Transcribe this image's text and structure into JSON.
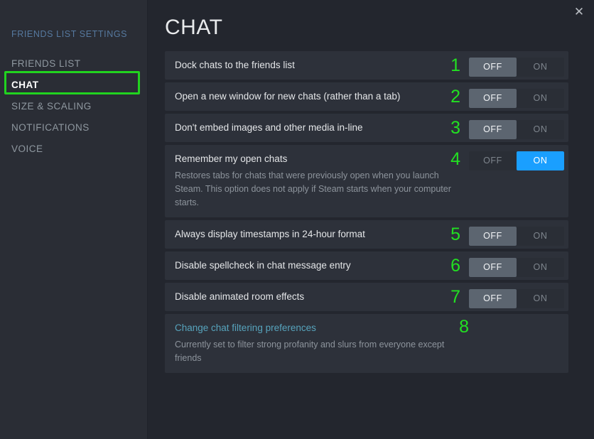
{
  "window": {
    "close_icon": "close-icon",
    "close_glyph": "✕",
    "background_color": "#23262e"
  },
  "sidebar": {
    "header": "FRIENDS LIST SETTINGS",
    "items": [
      {
        "label": "FRIENDS LIST",
        "active": false
      },
      {
        "label": "CHAT",
        "active": true
      },
      {
        "label": "SIZE & SCALING",
        "active": false
      },
      {
        "label": "NOTIFICATIONS",
        "active": false
      },
      {
        "label": "VOICE",
        "active": false
      }
    ],
    "highlight": {
      "target": "CHAT",
      "color": "#21d31f"
    }
  },
  "main": {
    "title": "CHAT",
    "accent_blue": "#1a9fff",
    "link_color": "#57a4bd",
    "annotation_color": "#22e022",
    "settings": [
      {
        "number": "1",
        "label": "Dock chats to the friends list",
        "toggle": {
          "off_label": "OFF",
          "on_label": "ON",
          "state": "OFF"
        }
      },
      {
        "number": "2",
        "label": "Open a new window for new chats (rather than a tab)",
        "toggle": {
          "off_label": "OFF",
          "on_label": "ON",
          "state": "OFF"
        }
      },
      {
        "number": "3",
        "label": "Don't embed images and other media in-line",
        "toggle": {
          "off_label": "OFF",
          "on_label": "ON",
          "state": "OFF"
        }
      },
      {
        "number": "4",
        "label": "Remember my open chats",
        "description": "Restores tabs for chats that were previously open when you launch Steam. This option does not apply if Steam starts when your computer starts.",
        "toggle": {
          "off_label": "OFF",
          "on_label": "ON",
          "state": "ON"
        }
      },
      {
        "number": "5",
        "label": "Always display timestamps in 24-hour format",
        "toggle": {
          "off_label": "OFF",
          "on_label": "ON",
          "state": "OFF"
        }
      },
      {
        "number": "6",
        "label": "Disable spellcheck in chat message entry",
        "toggle": {
          "off_label": "OFF",
          "on_label": "ON",
          "state": "OFF"
        }
      },
      {
        "number": "7",
        "label": "Disable animated room effects",
        "toggle": {
          "off_label": "OFF",
          "on_label": "ON",
          "state": "OFF"
        }
      },
      {
        "number": "8",
        "link": "Change chat filtering preferences",
        "description": "Currently set to filter strong profanity and slurs from everyone except friends"
      }
    ]
  }
}
